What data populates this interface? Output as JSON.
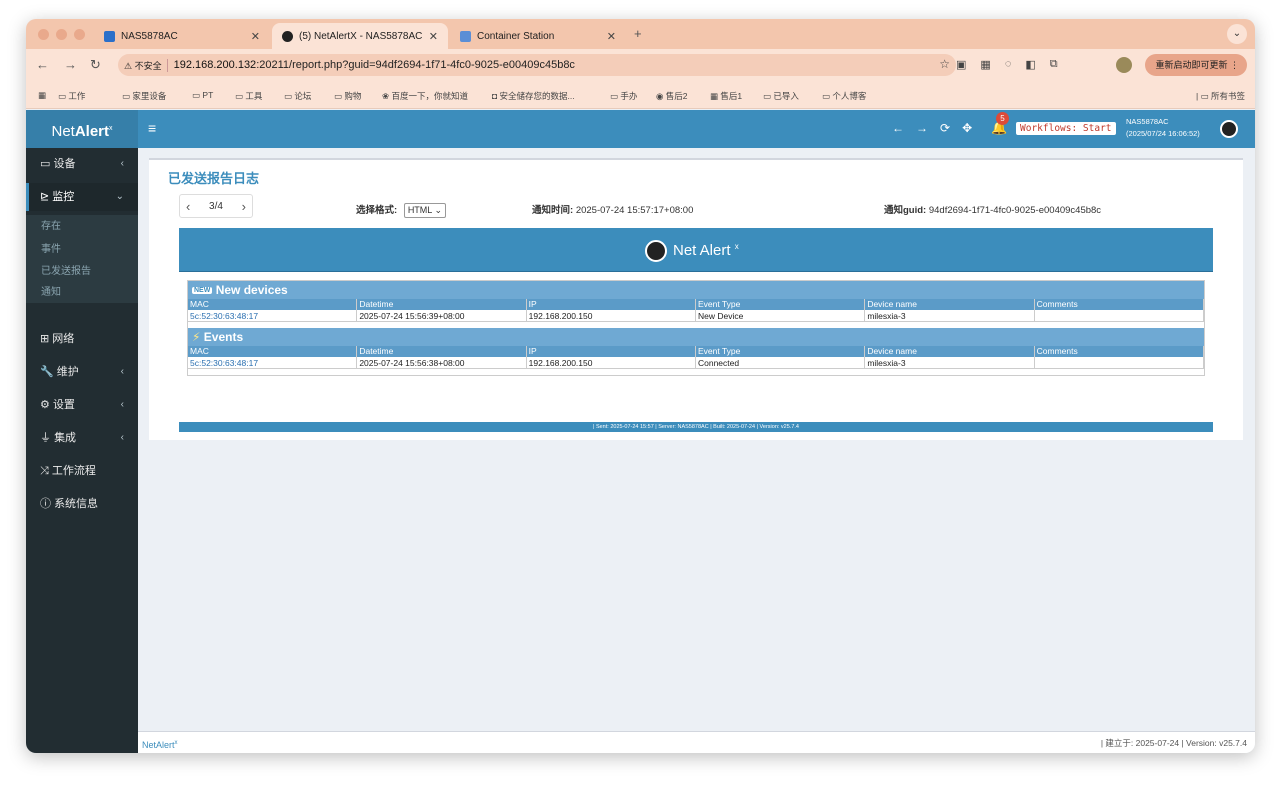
{
  "browser": {
    "tabs": [
      {
        "label": "NAS5878AC"
      },
      {
        "label": "(5) NetAlertX - NAS5878AC"
      },
      {
        "label": "Container Station"
      }
    ],
    "insecure_label": "不安全",
    "url_host": "192.168.200.132",
    "url_rest": ":20211/report.php?guid=94df2694-1f71-4fc0-9025-e00409c45b8c",
    "update_label": "重新启动即可更新",
    "bookmarks": [
      "工作",
      "家里设备",
      "PT",
      "工具",
      "论坛",
      "购物",
      "百度一下，你就知道",
      "安全储存您的数据...",
      "手办",
      "售后2",
      "售后1",
      "已导入",
      "个人博客"
    ],
    "all_bookmarks": "所有书签"
  },
  "app": {
    "logo_plain": "Net",
    "logo_bold": "Alert",
    "logo_sup": "x",
    "notif_count": "5",
    "workflows_label": "Workflows: Start",
    "server_name": "NAS5878AC",
    "server_time": "(2025/07/24 16:06:52)",
    "footer_left": "NetAlert",
    "footer_left_sup": "x",
    "footer_right": "| 建立于: 2025-07-24 | Version: v25.7.4"
  },
  "sidebar": {
    "devices": "设备",
    "monitor": "监控",
    "monitor_sub": [
      "存在",
      "事件",
      "已发送报告",
      "通知"
    ],
    "network": "网络",
    "maintenance": "维护",
    "settings": "设置",
    "integrations": "集成",
    "workflows": "工作流程",
    "sysinfo": "系统信息"
  },
  "report": {
    "page_title": "已发送报告日志",
    "pager": "3/4",
    "format_label": "选择格式:",
    "format_value": "HTML",
    "notify_time_label": "通知时间:",
    "notify_time": "2025-07-24 15:57:17+08:00",
    "guid_label": "通知guid:",
    "guid": "94df2694-1f71-4fc0-9025-e00409c45b8c",
    "banner": "Net Alert",
    "banner_sup": "x",
    "columns": [
      "MAC",
      "Datetime",
      "IP",
      "Event Type",
      "Device name",
      "Comments"
    ],
    "new_devices_title": "New devices",
    "new_devices": [
      {
        "mac": "5c:52:30:63:48:17",
        "datetime": "2025-07-24 15:56:39+08:00",
        "ip": "192.168.200.150",
        "event": "New Device",
        "device": "milesxia-3",
        "comments": ""
      }
    ],
    "events_title": "Events",
    "events": [
      {
        "mac": "5c:52:30:63:48:17",
        "datetime": "2025-07-24 15:56:38+08:00",
        "ip": "192.168.200.150",
        "event": "Connected",
        "device": "milesxia-3",
        "comments": ""
      }
    ],
    "footer": "| Sent: 2025-07-24 15:57 | Server: NAS5878AC | Built: 2025-07-24 | Version: v25.7.4"
  },
  "colors": {
    "header_blue": "#3c8dbc",
    "sidebar_dark": "#222d32",
    "tab_strip": "#f3c6ad"
  }
}
